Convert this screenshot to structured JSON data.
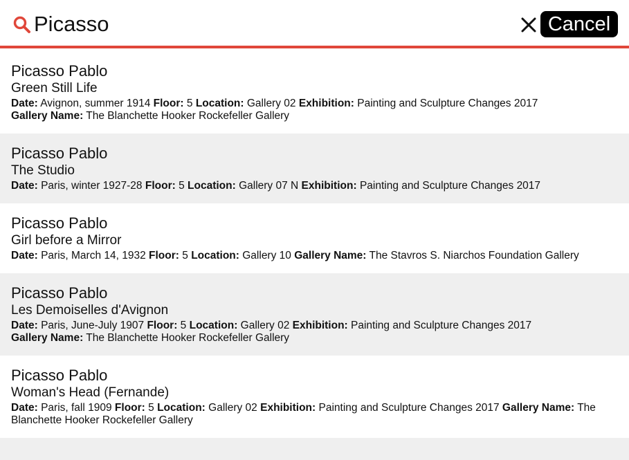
{
  "search": {
    "query": "Picasso",
    "cancel_label": "Cancel",
    "accent_color": "#e0473a",
    "search_icon": "search-icon",
    "clear_icon": "close-icon"
  },
  "labels": {
    "date": "Date:",
    "floor": "Floor:",
    "location": "Location:",
    "exhibition": "Exhibition:",
    "gallery_name": "Gallery Name:"
  },
  "results": [
    {
      "artist": "Picasso Pablo",
      "title": "Green Still Life",
      "date": "Avignon, summer 1914",
      "floor": "5",
      "location": "Gallery 02",
      "exhibition": "Painting and Sculpture Changes 2017",
      "gallery_name": "The Blanchette Hooker Rockefeller Gallery"
    },
    {
      "artist": "Picasso Pablo",
      "title": "The Studio",
      "date": "Paris, winter 1927-28",
      "floor": "5",
      "location": "Gallery 07 N",
      "exhibition": "Painting and Sculpture Changes 2017"
    },
    {
      "artist": "Picasso Pablo",
      "title": "Girl before a Mirror",
      "date": "Paris, March 14, 1932",
      "floor": "5",
      "location": "Gallery 10",
      "gallery_name": "The Stavros S. Niarchos Foundation Gallery"
    },
    {
      "artist": "Picasso Pablo",
      "title": "Les Demoiselles d'Avignon",
      "date": "Paris, June-July 1907",
      "floor": "5",
      "location": "Gallery 02",
      "exhibition": "Painting and Sculpture Changes 2017",
      "gallery_name": "The Blanchette Hooker Rockefeller Gallery"
    },
    {
      "artist": "Picasso Pablo",
      "title": "Woman's Head (Fernande)",
      "date": "Paris, fall 1909",
      "floor": "5",
      "location": "Gallery 02",
      "exhibition": "Painting and Sculpture Changes 2017",
      "gallery_name": "The Blanchette Hooker Rockefeller Gallery"
    }
  ]
}
